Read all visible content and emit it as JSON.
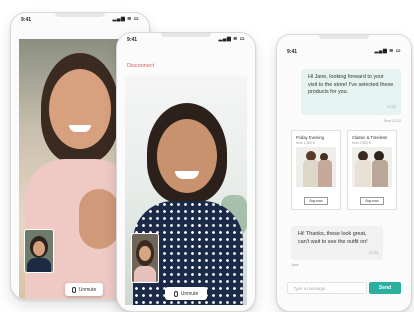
{
  "phone_left": {
    "time": "9:41",
    "unmute_label": "Unmute"
  },
  "phone_middle": {
    "time": "9:41",
    "header_title": "Disconnect",
    "unmute_label": "Unmute"
  },
  "phone_right": {
    "time": "9:41",
    "messages": [
      {
        "from": "agent",
        "text": "Hi Jane, looking forward to your visit to the store! I've selected these products for you.",
        "time": "17:22"
      },
      {
        "from": "customer",
        "text": "Hi! Thanks, these look great, can't wait to see the outfit on!",
        "time": "17:23"
      }
    ],
    "read_receipt": "Sent 12:32",
    "customer_name": "Jane",
    "products": [
      {
        "title": "Friday Evening",
        "subtitle": "from 1,900 €",
        "buy_label": "Buy now"
      },
      {
        "title": "Classic & Timeless",
        "subtitle": "from 2,500 €",
        "buy_label": "Buy now"
      }
    ],
    "input_placeholder": "Type a message...",
    "send_label": "Send"
  },
  "colors": {
    "accent": "#2bb0a0",
    "disconnect": "#e05a5a",
    "bubble_agent": "#e6f4f1"
  }
}
